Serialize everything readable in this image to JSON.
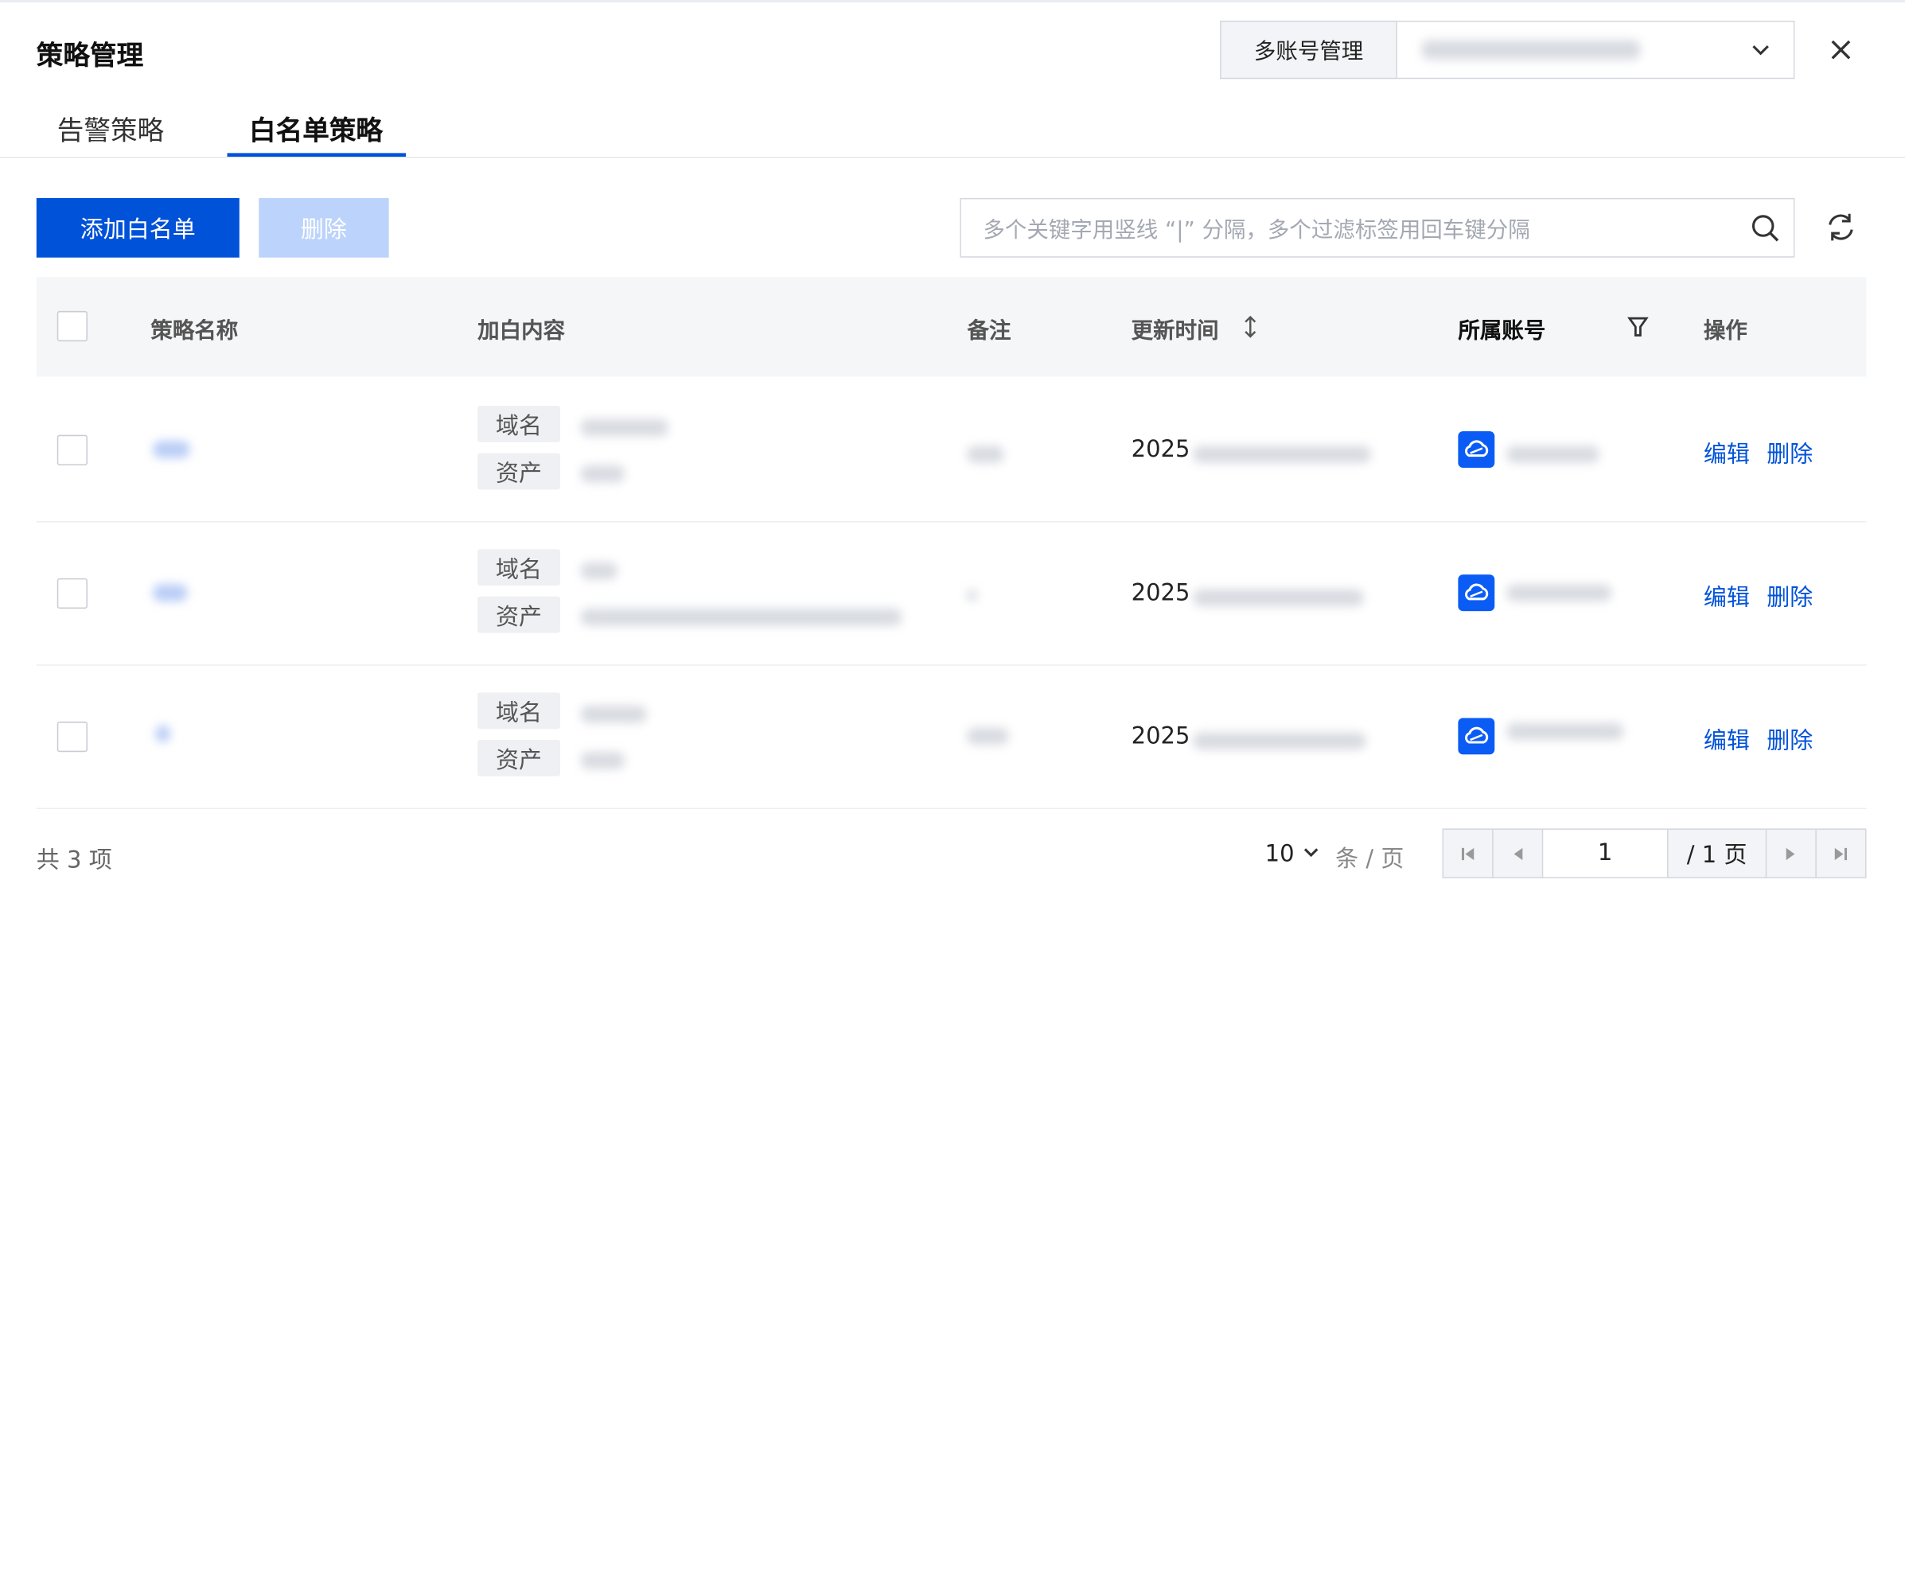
{
  "header": {
    "title": "策略管理",
    "multi_account_button": "多账号管理"
  },
  "tabs": [
    {
      "label": "告警策略",
      "active": false
    },
    {
      "label": "白名单策略",
      "active": true
    }
  ],
  "toolbar": {
    "add_label": "添加白名单",
    "delete_label": "删除",
    "search_placeholder": "多个关键字用竖线 “|” 分隔，多个过滤标签用回车键分隔"
  },
  "table": {
    "columns": {
      "name": "策略名称",
      "content": "加白内容",
      "remark": "备注",
      "updated": "更新时间",
      "account": "所属账号",
      "action": "操作"
    },
    "rows": [
      {
        "tag1": "域名",
        "tag2": "资产",
        "date_prefix": "2025",
        "edit": "编辑",
        "delete": "删除"
      },
      {
        "tag1": "域名",
        "tag2": "资产",
        "date_prefix": "2025",
        "edit": "编辑",
        "delete": "删除"
      },
      {
        "tag1": "域名",
        "tag2": "资产",
        "date_prefix": "2025",
        "edit": "编辑",
        "delete": "删除"
      }
    ]
  },
  "footer": {
    "total": "共 3 项",
    "page_size": "10",
    "page_size_unit": "条 / 页",
    "current_page": "1",
    "total_pages": "/ 1 页"
  },
  "colors": {
    "accent": "#0052d9",
    "disabled": "#bcd3fb",
    "cloud_icon": "#0b5cf5"
  },
  "icons": [
    "chevron-down-icon",
    "close-icon",
    "search-icon",
    "refresh-icon",
    "sort-icon",
    "filter-icon",
    "cloud-icon",
    "first-page-icon",
    "prev-page-icon",
    "next-page-icon",
    "last-page-icon"
  ]
}
